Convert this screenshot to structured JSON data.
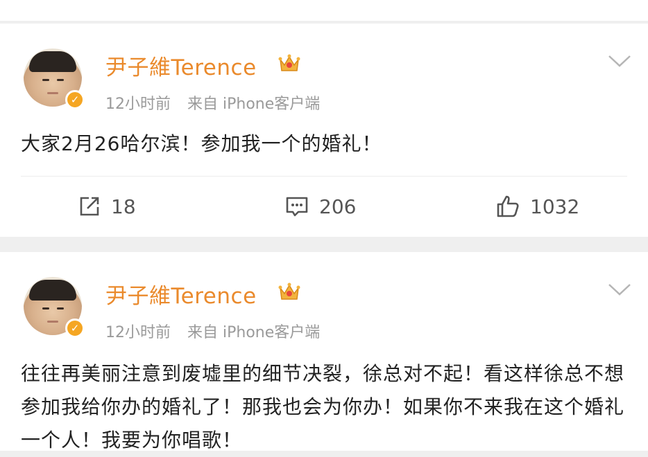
{
  "posts": [
    {
      "username": "尹子維Terence",
      "time": "12小时前",
      "source": "来自 iPhone客户端",
      "text": "大家2月26哈尔滨！参加我一个的婚礼！",
      "actions": {
        "repost": "18",
        "comment": "206",
        "like": "1032"
      }
    },
    {
      "username": "尹子維Terence",
      "time": "12小时前",
      "source": "来自 iPhone客户端",
      "text": "往往再美丽注意到废墟里的细节决裂，徐总对不起！看这样徐总不想参加我给你办的婚礼了！那我也会为你办！如果你不来我在这个婚礼一个人！我要为你唱歌！"
    }
  ],
  "icons": {
    "verified": "verified-badge-icon",
    "crown": "crown-icon",
    "chevron": "chevron-down-icon",
    "repost": "repost-icon",
    "comment": "comment-icon",
    "like": "like-icon"
  },
  "colors": {
    "username": "#ea8a2c",
    "verified": "#f5a623",
    "meta": "#9a9a9a",
    "text": "#222222",
    "background": "#efefef"
  }
}
